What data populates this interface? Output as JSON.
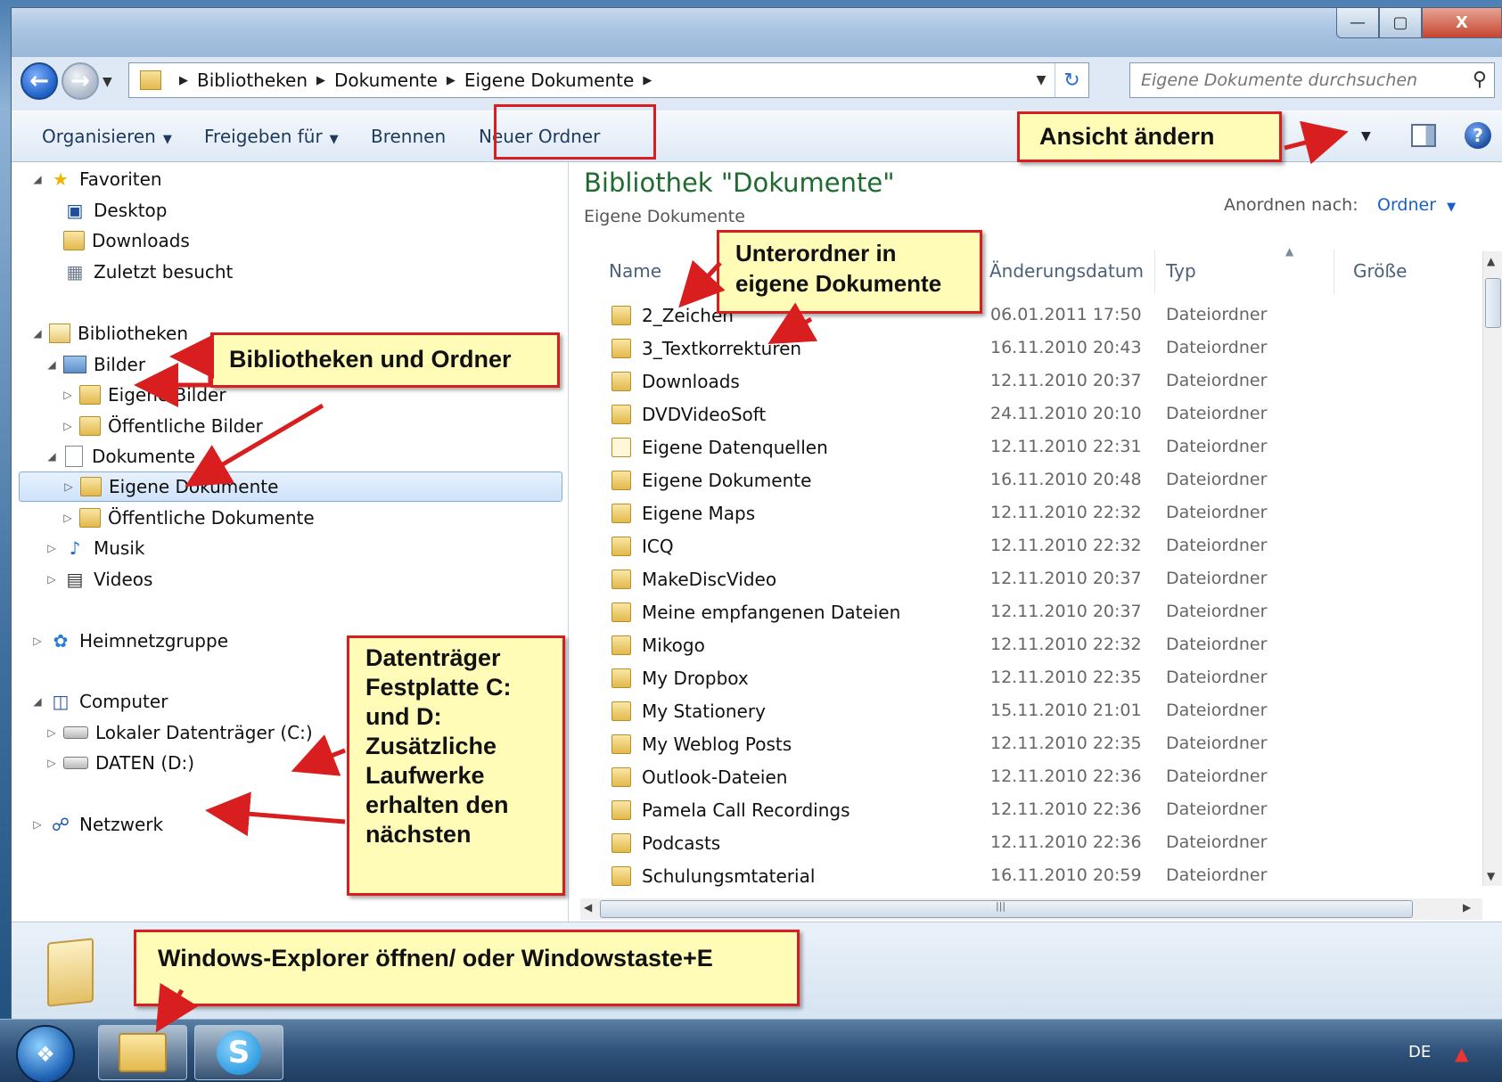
{
  "window": {
    "controls": {
      "minimize": "—",
      "maximize": "▢",
      "close": "X"
    }
  },
  "navigation": {
    "back_icon": "back-arrow-icon",
    "forward_icon": "forward-arrow-icon",
    "breadcrumb": [
      "Bibliotheken",
      "Dokumente",
      "Eigene Dokumente"
    ],
    "search_placeholder": "Eigene Dokumente durchsuchen"
  },
  "toolbar": {
    "organize": "Organisieren",
    "share": "Freigeben für",
    "burn": "Brennen",
    "new_folder": "Neuer Ordner"
  },
  "nav_pane": {
    "favorites": "Favoriten",
    "desktop": "Desktop",
    "downloads": "Downloads",
    "recent": "Zuletzt besucht",
    "libraries": "Bibliotheken",
    "pictures": "Bilder",
    "my_pictures": "Eigene Bilder",
    "public_pictures": "Öffentliche Bilder",
    "documents": "Dokumente",
    "my_documents": "Eigene Dokumente",
    "public_documents": "Öffentliche Dokumente",
    "music": "Musik",
    "videos": "Videos",
    "homegroup": "Heimnetzgruppe",
    "computer": "Computer",
    "drive_c": "Lokaler Datenträger (C:)",
    "drive_d": "DATEN (D:)",
    "network": "Netzwerk"
  },
  "content": {
    "library_title": "Bibliothek \"Dokumente\"",
    "library_subtitle": "Eigene Dokumente",
    "arrange_label": "Anordnen nach:",
    "arrange_value": "Ordner",
    "columns": {
      "name": "Name",
      "date": "Änderungsdatum",
      "type": "Typ",
      "size": "Größe"
    },
    "files": [
      {
        "name": "2_Zeichen",
        "date": "06.01.2011 17:50",
        "type": "Dateiordner"
      },
      {
        "name": "3_Textkorrekturen",
        "date": "16.11.2010 20:43",
        "type": "Dateiordner"
      },
      {
        "name": "Downloads",
        "date": "12.11.2010 20:37",
        "type": "Dateiordner"
      },
      {
        "name": "DVDVideoSoft",
        "date": "24.11.2010 20:10",
        "type": "Dateiordner"
      },
      {
        "name": "Eigene Datenquellen",
        "date": "12.11.2010 22:31",
        "type": "Dateiordner"
      },
      {
        "name": "Eigene Dokumente",
        "date": "16.11.2010 20:48",
        "type": "Dateiordner"
      },
      {
        "name": "Eigene Maps",
        "date": "12.11.2010 22:32",
        "type": "Dateiordner"
      },
      {
        "name": "ICQ",
        "date": "12.11.2010 22:32",
        "type": "Dateiordner"
      },
      {
        "name": "MakeDiscVideo",
        "date": "12.11.2010 20:37",
        "type": "Dateiordner"
      },
      {
        "name": "Meine empfangenen Dateien",
        "date": "12.11.2010 20:37",
        "type": "Dateiordner"
      },
      {
        "name": "Mikogo",
        "date": "12.11.2010 22:32",
        "type": "Dateiordner"
      },
      {
        "name": "My Dropbox",
        "date": "12.11.2010 22:35",
        "type": "Dateiordner"
      },
      {
        "name": "My Stationery",
        "date": "15.11.2010 21:01",
        "type": "Dateiordner"
      },
      {
        "name": "My Weblog Posts",
        "date": "12.11.2010 22:35",
        "type": "Dateiordner"
      },
      {
        "name": "Outlook-Dateien",
        "date": "12.11.2010 22:36",
        "type": "Dateiordner"
      },
      {
        "name": "Pamela Call Recordings",
        "date": "12.11.2010 22:36",
        "type": "Dateiordner"
      },
      {
        "name": "Podcasts",
        "date": "12.11.2010 22:36",
        "type": "Dateiordner"
      },
      {
        "name": "Schulungsmtaterial",
        "date": "16.11.2010 20:59",
        "type": "Dateiordner"
      }
    ]
  },
  "callouts": {
    "view": "Ansicht ändern",
    "subfolders_line1": "Unterordner in",
    "subfolders_line2": "eigene Dokumente",
    "libraries": "Bibliotheken und Ordner",
    "drives": [
      "Datenträger",
      "Festplatte C:",
      "und D:",
      "Zusätzliche",
      "Laufwerke",
      "erhalten den",
      "nächsten"
    ],
    "explorer": "Windows-Explorer öffnen/ oder Windowstaste+E"
  },
  "taskbar": {
    "language": "DE",
    "skype_letter": "S"
  },
  "colors": {
    "callout_bg": "#fffcb8",
    "callout_border": "#d81e1e",
    "library_title": "#1e6b2f",
    "link_blue": "#1a5fc4"
  }
}
